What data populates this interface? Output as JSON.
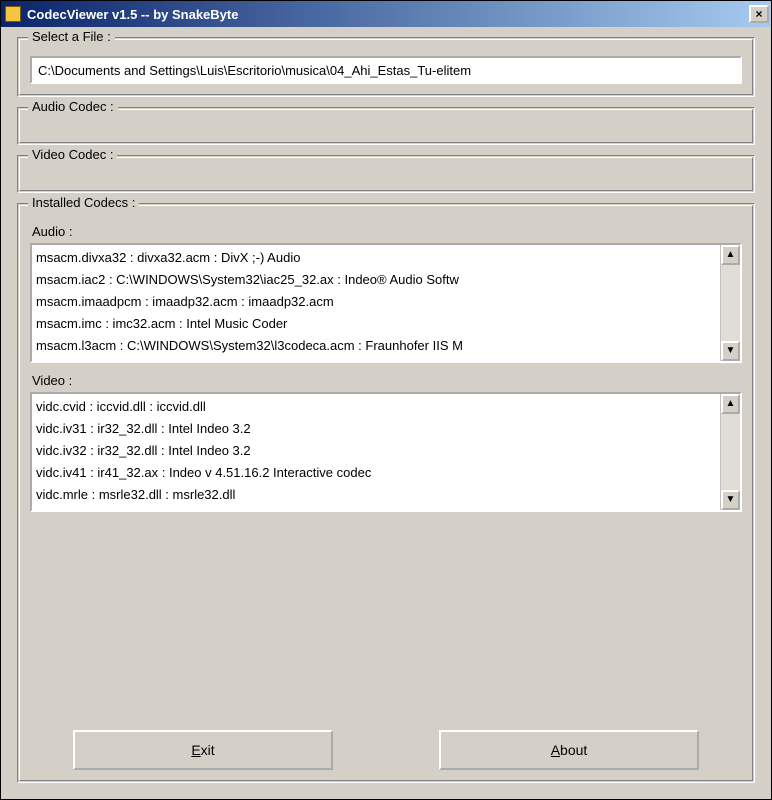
{
  "window": {
    "title": "CodecViewer v1.5  --  by SnakeByte",
    "close_glyph": "×"
  },
  "select_file": {
    "legend": "Select a File :",
    "value": "C:\\Documents and Settings\\Luis\\Escritorio\\musica\\04_Ahi_Estas_Tu-elitem"
  },
  "audio_codec": {
    "legend": "Audio Codec :",
    "value": ""
  },
  "video_codec": {
    "legend": "Video Codec :",
    "value": ""
  },
  "installed": {
    "legend": "Installed Codecs :",
    "audio_label": "Audio :",
    "video_label": "Video :",
    "scroll_up": "▲",
    "scroll_down": "▼",
    "audio_rows": [
      "msacm.divxa32 : divxa32.acm : DivX ;-) Audio",
      "msacm.iac2 : C:\\WINDOWS\\System32\\iac25_32.ax : Indeo® Audio Softw",
      "msacm.imaadpcm : imaadp32.acm : imaadp32.acm",
      "msacm.imc : imc32.acm : Intel Music Coder",
      "msacm.l3acm : C:\\WINDOWS\\System32\\l3codeca.acm : Fraunhofer IIS M"
    ],
    "video_rows": [
      "vidc.cvid : iccvid.dll : iccvid.dll",
      "vidc.iv31 : ir32_32.dll : Intel Indeo 3.2",
      "vidc.iv32 : ir32_32.dll : Intel Indeo 3.2",
      "vidc.iv41 : ir41_32.ax : Indeo v 4.51.16.2 Interactive codec",
      "vidc.mrle : msrle32.dll : msrle32.dll"
    ]
  },
  "buttons": {
    "exit": "Exit",
    "about": "About"
  }
}
